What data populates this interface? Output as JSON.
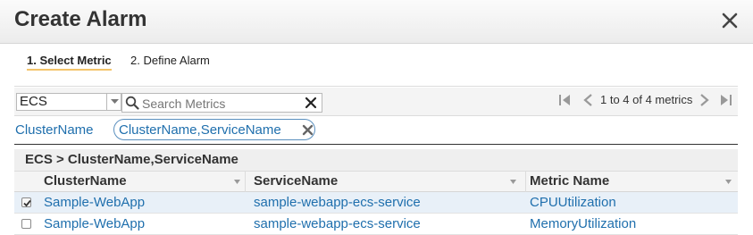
{
  "dialog": {
    "title": "Create Alarm",
    "close_icon": "close-icon"
  },
  "steps": [
    {
      "label": "1. Select Metric",
      "active": true
    },
    {
      "label": "2. Define Alarm",
      "active": false
    }
  ],
  "toolbar": {
    "namespace_value": "ECS",
    "search_placeholder": "Search Metrics",
    "pager_text": "1 to 4 of 4 metrics",
    "icons": [
      "first-page-icon",
      "prev-page-icon",
      "next-page-icon",
      "last-page-icon"
    ]
  },
  "dimensions": {
    "parent_link": "ClusterName",
    "selected_tag": "ClusterName,ServiceName"
  },
  "group": {
    "label": "ECS > ClusterName,ServiceName"
  },
  "table": {
    "columns": [
      "ClusterName",
      "ServiceName",
      "Metric Name"
    ],
    "rows": [
      {
        "checked": true,
        "cluster": "Sample-WebApp",
        "service": "sample-webapp-ecs-service",
        "metric": "CPUUtilization"
      },
      {
        "checked": false,
        "cluster": "Sample-WebApp",
        "service": "sample-webapp-ecs-service",
        "metric": "MemoryUtilization"
      }
    ]
  },
  "colors": {
    "link": "#1f6fad",
    "selected_row": "#e8f0f8",
    "active_step_underline": "#f3c46a"
  }
}
